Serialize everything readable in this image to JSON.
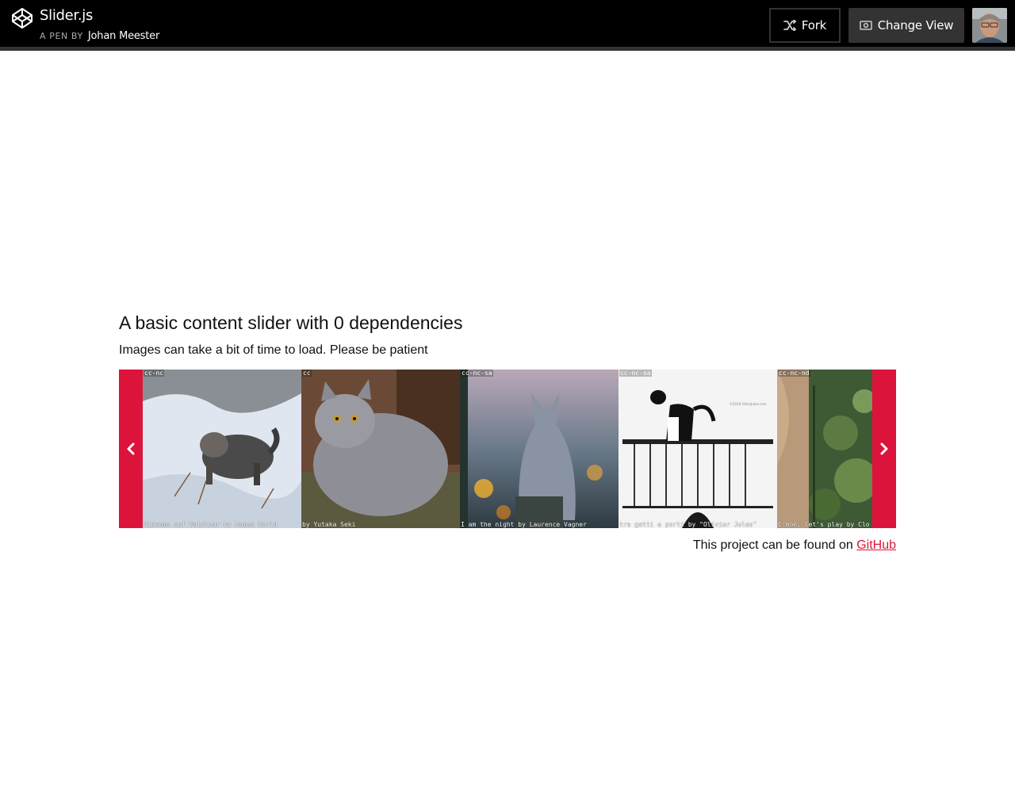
{
  "header": {
    "title": "Slider.js",
    "by_label": "A PEN BY",
    "author": "Johan Meester",
    "fork_label": "Fork",
    "change_view_label": "Change View",
    "icons": [
      "codepen-logo-icon",
      "fork-icon",
      "eye-icon",
      "avatar"
    ]
  },
  "main": {
    "heading": "A basic content slider with 0 dependencies",
    "subheading": "Images can take a bit of time to load. Please be patient"
  },
  "slider": {
    "accent_color": "#dc143c",
    "prev_icon": "chevron-left-icon",
    "next_icon": "chevron-right-icon",
    "slides": [
      {
        "license": "cc-nc",
        "caption": "Giacomo auf Waldtour by Mumes World"
      },
      {
        "license": "cc",
        "caption": "by Yutaka Seki"
      },
      {
        "license": "cc-nc-sa",
        "caption": "I am the night by Laurence Vagner"
      },
      {
        "license": "cc-nc-sa",
        "caption": "tra gatti e porti by \"Olivier Jules\""
      },
      {
        "license": "cc-nc-nd",
        "caption": "C'mon, let's play by Clo"
      }
    ]
  },
  "footer": {
    "text": "This project can be found on",
    "link_label": "GitHub"
  }
}
